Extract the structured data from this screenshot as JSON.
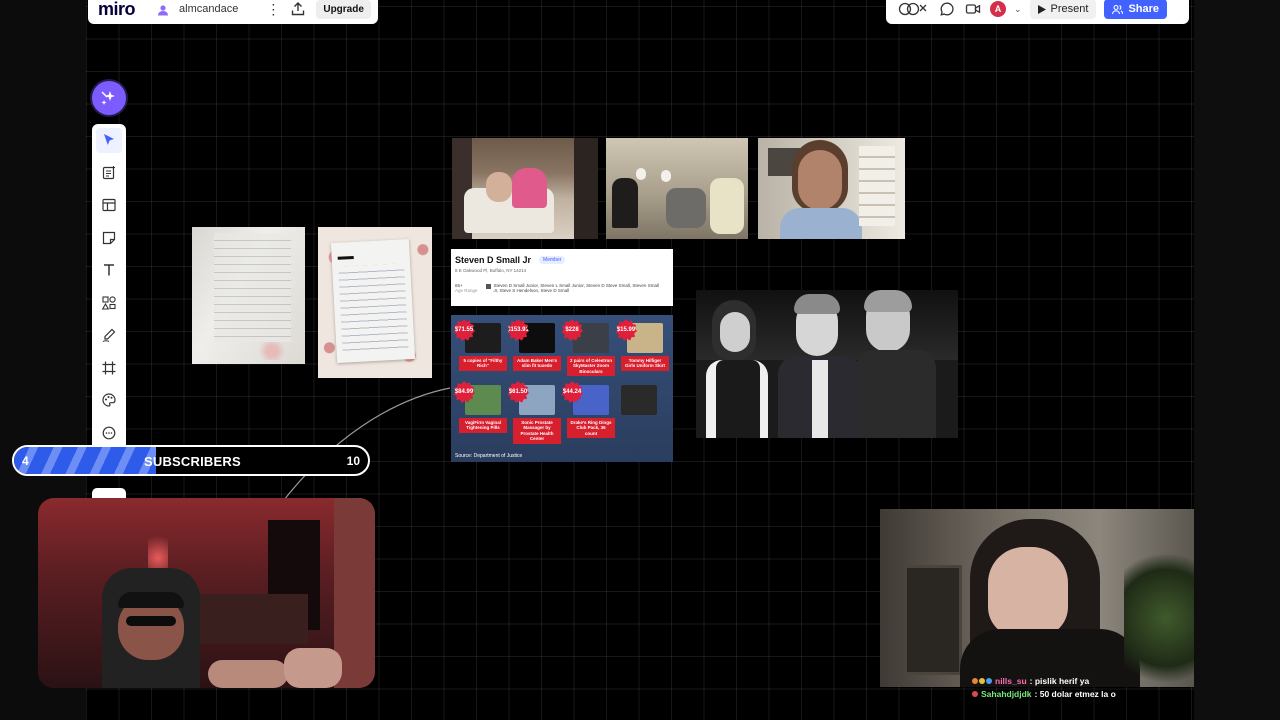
{
  "app": {
    "logo": "miro",
    "board_name": "almcandace",
    "upgrade_label": "Upgrade",
    "present_label": "Present",
    "share_label": "Share",
    "user_avatar_initial": "A",
    "accent_color": "#4262ff",
    "ai_button_color": "#7c5cff"
  },
  "toolbar": {
    "tools": [
      {
        "name": "select",
        "icon": "cursor-arrow-icon"
      },
      {
        "name": "templates",
        "icon": "notes-add-icon"
      },
      {
        "name": "frame-layout",
        "icon": "layout-icon"
      },
      {
        "name": "sticky-note",
        "icon": "sticky-note-icon"
      },
      {
        "name": "text",
        "icon": "text-icon"
      },
      {
        "name": "shapes",
        "icon": "shapes-icon"
      },
      {
        "name": "pen",
        "icon": "pen-icon"
      },
      {
        "name": "frame",
        "icon": "frame-icon"
      },
      {
        "name": "palette",
        "icon": "palette-icon"
      },
      {
        "name": "comment",
        "icon": "comment-icon"
      }
    ]
  },
  "canvas": {
    "profile_card": {
      "name": "Steven D Small Jr",
      "badge": "Member",
      "address": "8 E Oakwood Pl, Buffalo, NY 14214",
      "age": "65+",
      "age_meta": "Age Range",
      "aliases": "Steven D Small Junior, Steven L Small Junior, Steven D Steve Small, Steven Small Jr, Steve S Hendelson, Steve D Small"
    },
    "evidence_board": {
      "source": "Source: Department of Justice",
      "items": [
        {
          "price": "$71.55",
          "label": "5 copies of \"Filthy Rich\"",
          "color": "#1d1d1d"
        },
        {
          "price": "$153.91",
          "label": "Adam Baker Men's slim fit tuxedo",
          "color": "#0d0d0d"
        },
        {
          "price": "$228",
          "label": "2 pairs of Celestron SkyMaster Zoom Binoculars",
          "color": "#3b4048"
        },
        {
          "price": "$15.99",
          "label": "Tommy Hilfiger Girls Uniform Skirt",
          "color": "#c9b48a"
        },
        {
          "price": "$84.99",
          "label": "VagiFirm Vaginal Tightening Pills",
          "color": "#5c8a4f"
        },
        {
          "price": "$61.50",
          "label": "Sonic Prostate Massager by Prostate Health Center",
          "color": "#8ea5c2"
        },
        {
          "price": "$44.24",
          "label": "Drake's Ring Dings Club Pack, 36 count",
          "color": "#4a63c9"
        },
        {
          "price": "",
          "label": "",
          "color": "#2a2a2a"
        }
      ]
    }
  },
  "stream": {
    "sub_goal": {
      "current": "4",
      "label": "SUBSCRIBERS",
      "target": "10",
      "progress": 0.4
    },
    "chat": [
      {
        "user": "nills_su",
        "message": ": pislik herif ya"
      },
      {
        "user": "Sahahdjdjdk",
        "message": ": 50 dolar etmez la o"
      }
    ]
  }
}
